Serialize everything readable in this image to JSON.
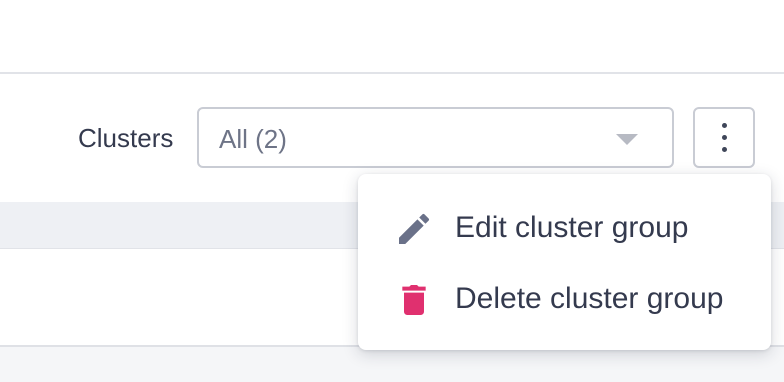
{
  "toolbar": {
    "clusters_label": "Clusters",
    "clusters_select_value": "All (2)"
  },
  "menu": {
    "items": [
      {
        "label": "Edit cluster group",
        "icon": "pencil-icon",
        "color": "#6a7189"
      },
      {
        "label": "Delete cluster group",
        "icon": "trash-icon",
        "color": "#e0306f"
      }
    ]
  },
  "colors": {
    "text": "#343a4e",
    "muted": "#6e7487",
    "border": "#c9ccd4",
    "danger": "#e0306f",
    "background": "#f5f6f8"
  }
}
